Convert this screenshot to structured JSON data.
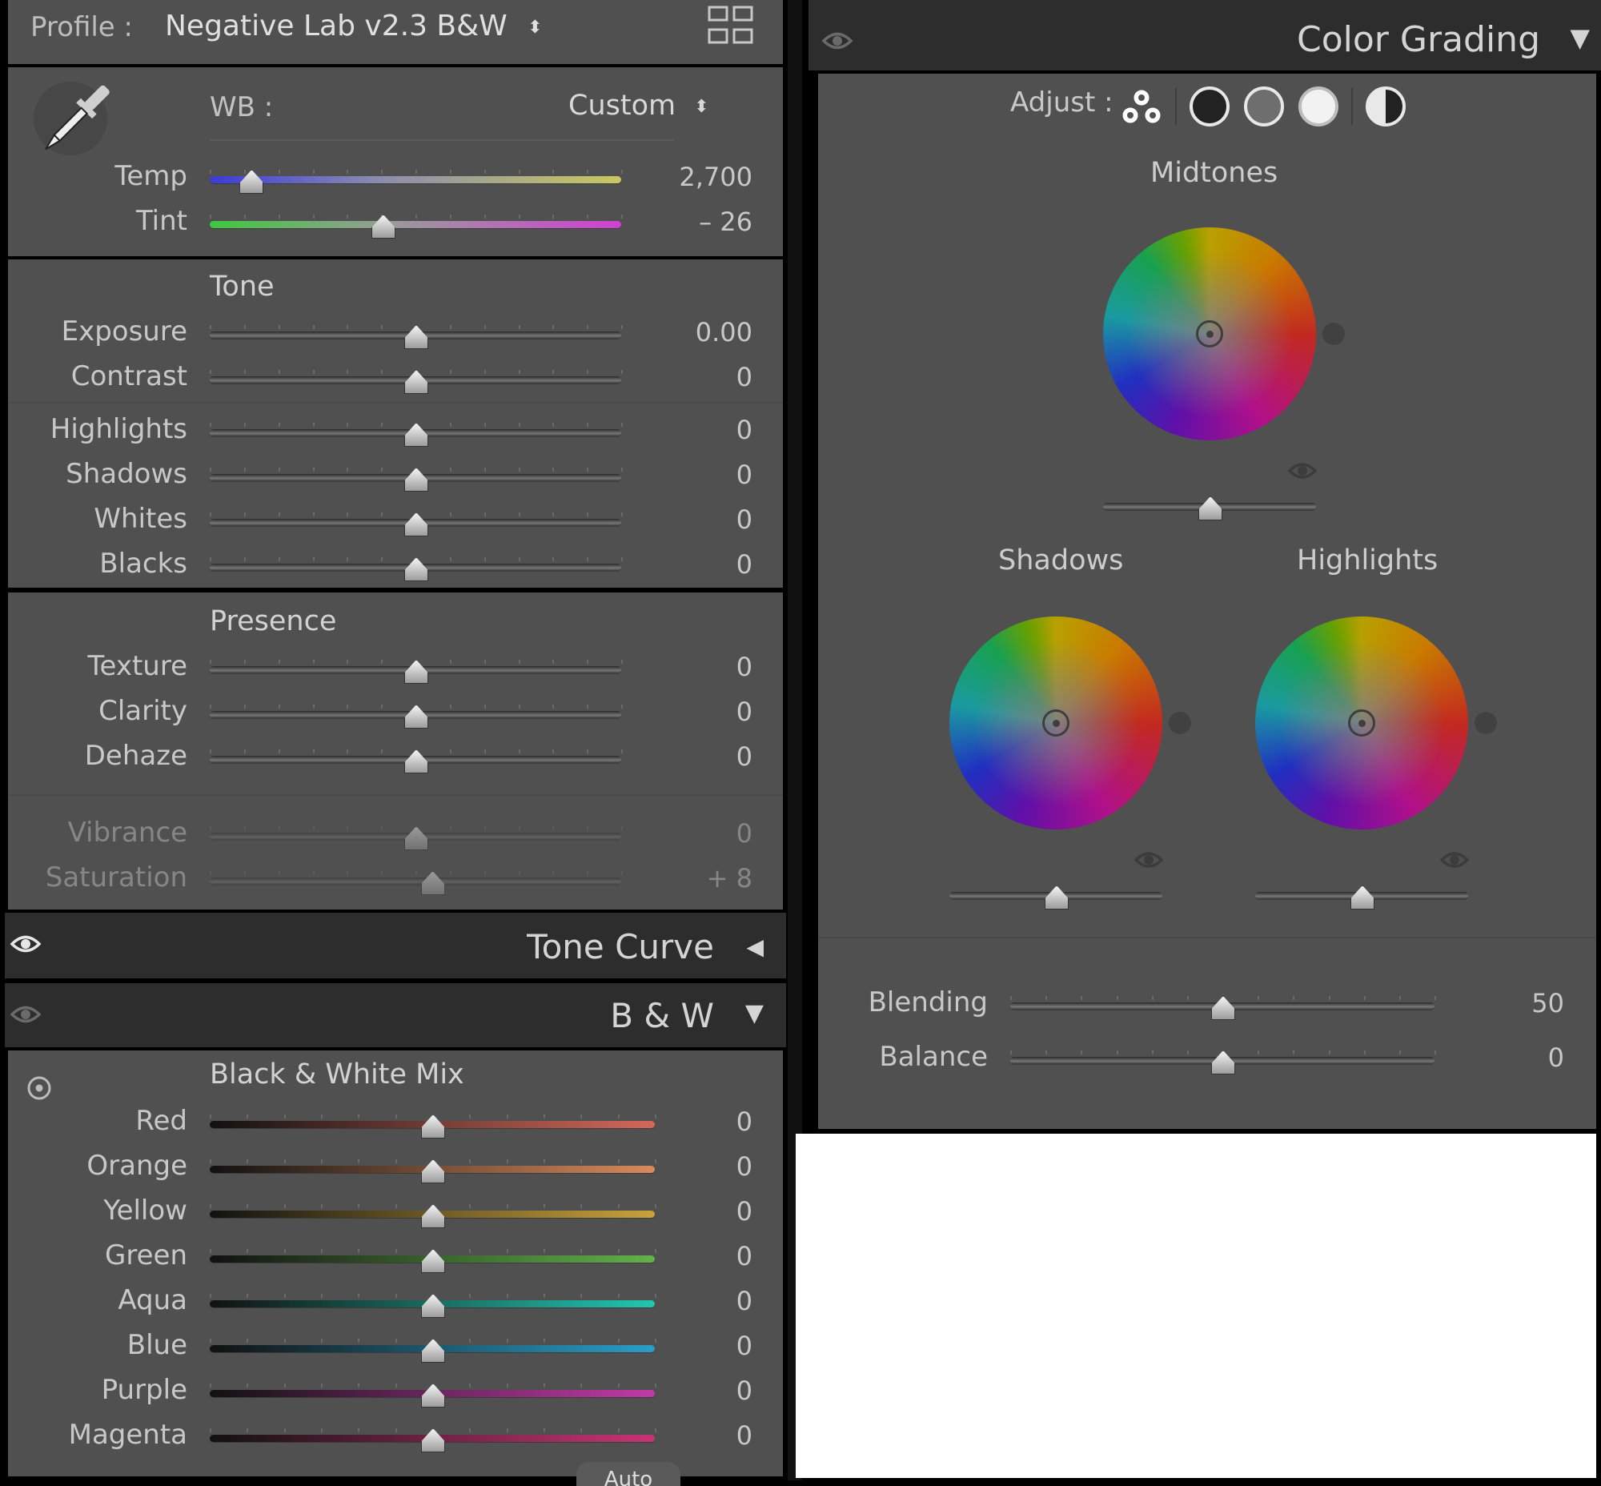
{
  "profile": {
    "label": "Profile :",
    "value": "Negative Lab v2.3 B&W"
  },
  "wb": {
    "label": "WB :",
    "value": "Custom",
    "temp": {
      "label": "Temp",
      "value": "2,700",
      "position": 0.1
    },
    "tint": {
      "label": "Tint",
      "value": "– 26",
      "position": 0.42
    }
  },
  "tone": {
    "title": "Tone",
    "sliders": [
      {
        "label": "Exposure",
        "value": "0.00",
        "position": 0.5
      },
      {
        "label": "Contrast",
        "value": "0",
        "position": 0.5
      },
      {
        "label": "Highlights",
        "value": "0",
        "position": 0.5
      },
      {
        "label": "Shadows",
        "value": "0",
        "position": 0.5
      },
      {
        "label": "Whites",
        "value": "0",
        "position": 0.5
      },
      {
        "label": "Blacks",
        "value": "0",
        "position": 0.5
      }
    ]
  },
  "presence": {
    "title": "Presence",
    "sliders": [
      {
        "label": "Texture",
        "value": "0",
        "position": 0.5
      },
      {
        "label": "Clarity",
        "value": "0",
        "position": 0.5
      },
      {
        "label": "Dehaze",
        "value": "0",
        "position": 0.5
      }
    ],
    "disabled_sliders": [
      {
        "label": "Vibrance",
        "value": "0",
        "position": 0.5
      },
      {
        "label": "Saturation",
        "value": "+ 8",
        "position": 0.54
      }
    ]
  },
  "tone_curve": {
    "title": "Tone Curve"
  },
  "bw": {
    "title": "B & W",
    "mix_title": "Black & White Mix",
    "auto_label": "Auto",
    "sliders": [
      {
        "label": "Red",
        "value": "0",
        "position": 0.5,
        "color": "#d4685a"
      },
      {
        "label": "Orange",
        "value": "0",
        "position": 0.5,
        "color": "#d88a5c"
      },
      {
        "label": "Yellow",
        "value": "0",
        "position": 0.5,
        "color": "#c9a23a"
      },
      {
        "label": "Green",
        "value": "0",
        "position": 0.5,
        "color": "#62b24a"
      },
      {
        "label": "Aqua",
        "value": "0",
        "position": 0.5,
        "color": "#22c6b0"
      },
      {
        "label": "Blue",
        "value": "0",
        "position": 0.5,
        "color": "#2a9ec8"
      },
      {
        "label": "Purple",
        "value": "0",
        "position": 0.5,
        "color": "#c23aa8"
      },
      {
        "label": "Magenta",
        "value": "0",
        "position": 0.5,
        "color": "#c83474"
      }
    ]
  },
  "color_grading": {
    "title": "Color Grading",
    "adjust_label": "Adjust :",
    "midtones": {
      "label": "Midtones",
      "luminance": 0.5
    },
    "shadows": {
      "label": "Shadows",
      "luminance": 0.5
    },
    "highlights": {
      "label": "Highlights",
      "luminance": 0.5
    },
    "blending": {
      "label": "Blending",
      "value": "50",
      "position": 0.5
    },
    "balance": {
      "label": "Balance",
      "value": "0",
      "position": 0.5
    }
  }
}
